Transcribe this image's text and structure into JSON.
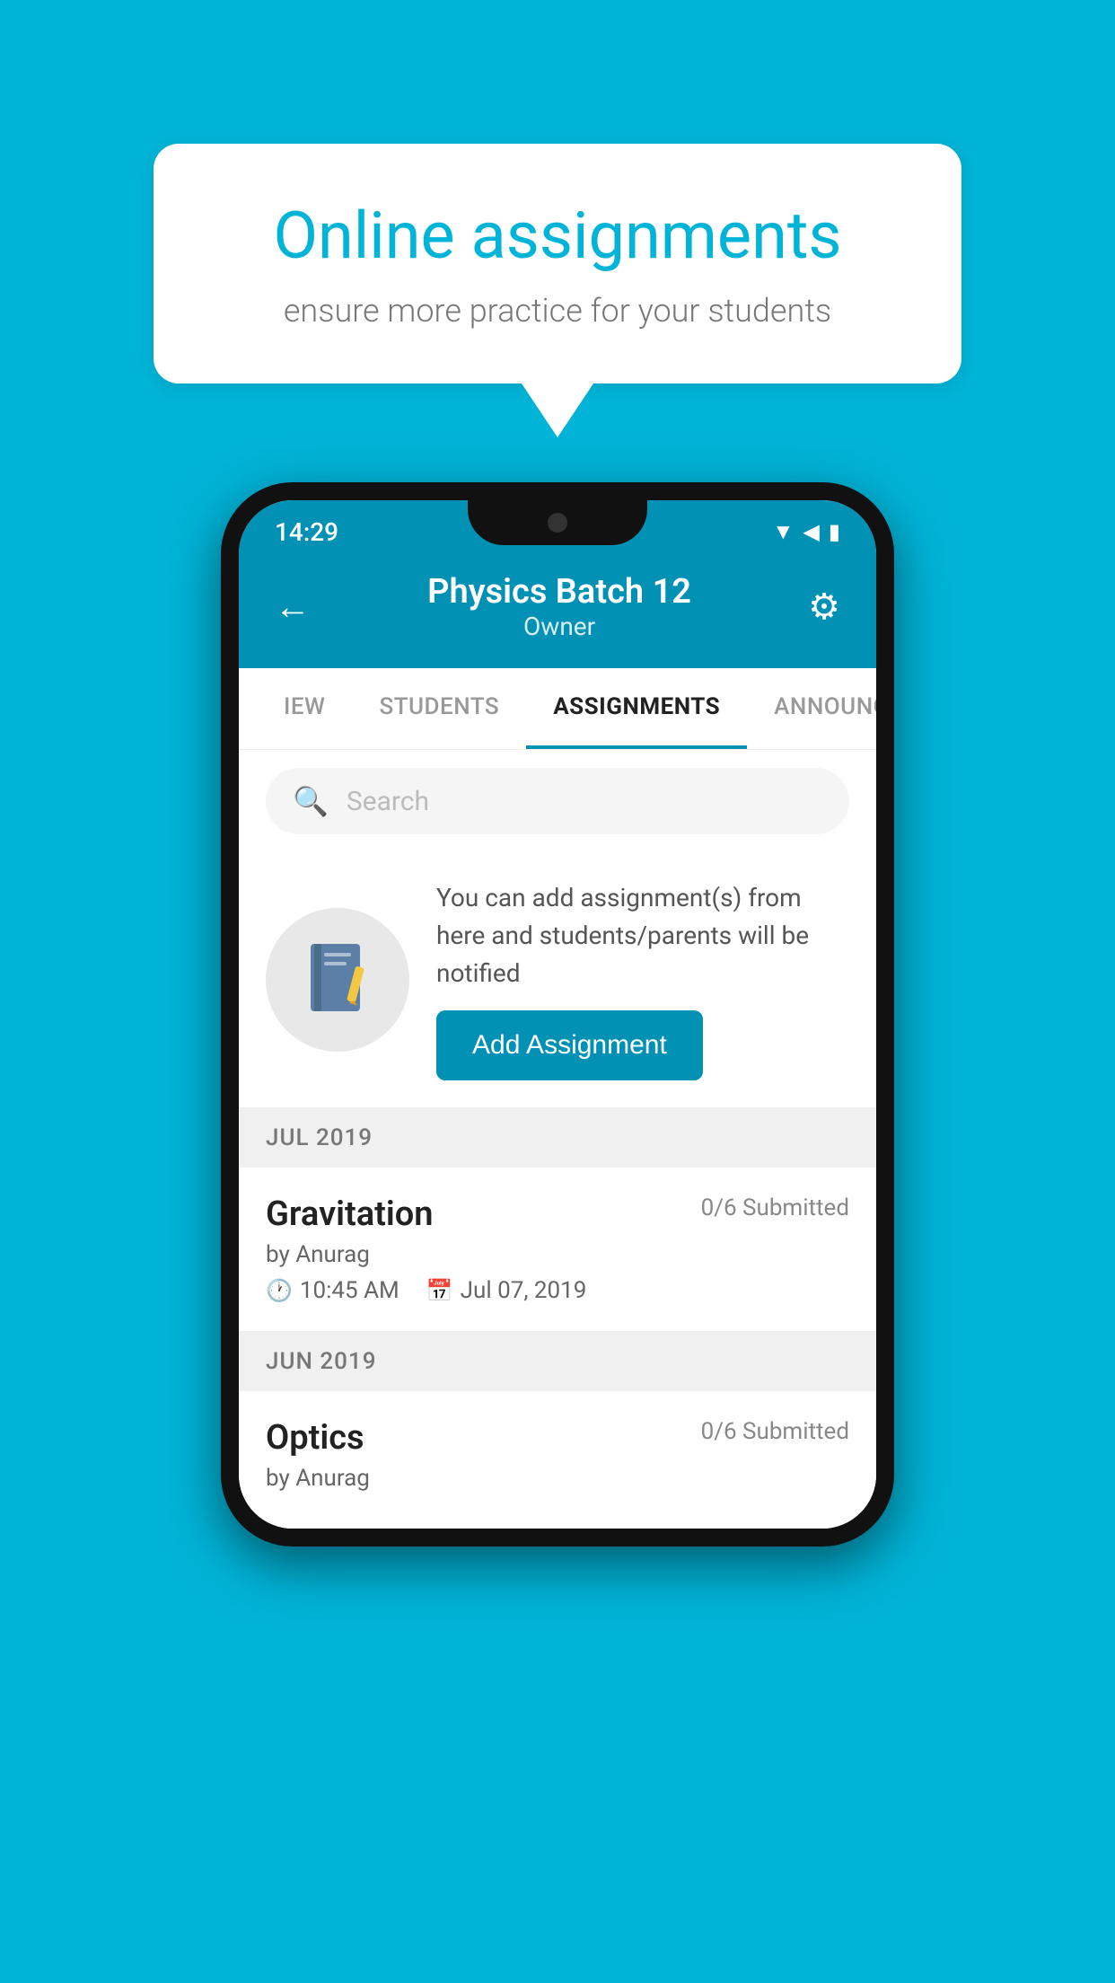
{
  "background_color": "#00b4d8",
  "speech_bubble": {
    "title": "Online assignments",
    "subtitle": "ensure more practice for your students"
  },
  "status_bar": {
    "time": "14:29",
    "icons": [
      "wifi",
      "signal",
      "battery"
    ]
  },
  "header": {
    "title": "Physics Batch 12",
    "subtitle": "Owner",
    "back_icon": "←",
    "settings_icon": "⚙"
  },
  "tabs": [
    {
      "label": "IEW",
      "active": false
    },
    {
      "label": "STUDENTS",
      "active": false
    },
    {
      "label": "ASSIGNMENTS",
      "active": true
    },
    {
      "label": "ANNOUNCEM...",
      "active": false
    }
  ],
  "search": {
    "placeholder": "Search"
  },
  "promo": {
    "text": "You can add assignment(s) from here and students/parents will be notified",
    "button_label": "Add Assignment"
  },
  "month_sections": [
    {
      "label": "JUL 2019",
      "assignments": [
        {
          "title": "Gravitation",
          "submitted": "0/6 Submitted",
          "by": "by Anurag",
          "time": "10:45 AM",
          "date": "Jul 07, 2019"
        }
      ]
    },
    {
      "label": "JUN 2019",
      "assignments": [
        {
          "title": "Optics",
          "submitted": "0/6 Submitted",
          "by": "by Anurag",
          "time": "",
          "date": ""
        }
      ]
    }
  ]
}
